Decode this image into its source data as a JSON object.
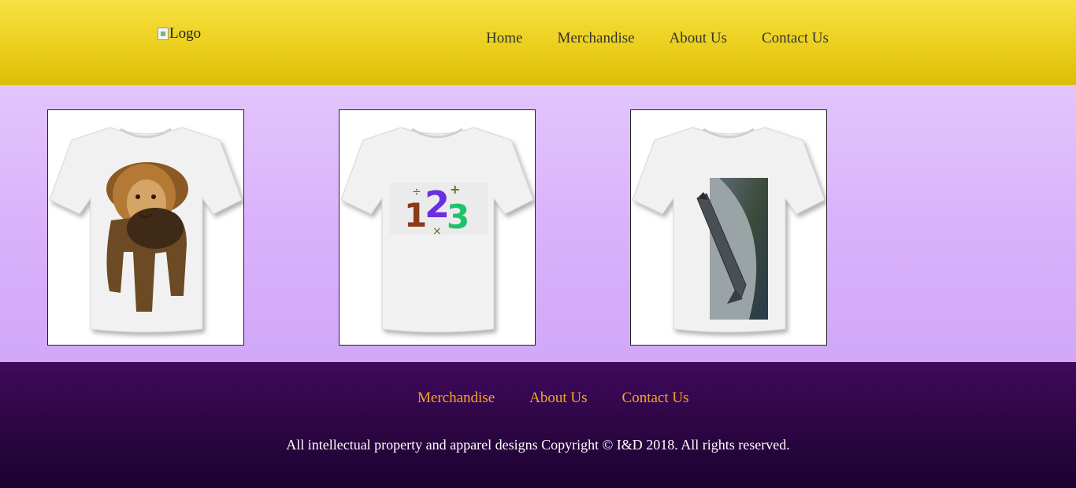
{
  "header": {
    "logo_alt": "Logo",
    "nav": [
      "Home",
      "Merchandise",
      "About Us",
      "Contact Us"
    ]
  },
  "products": [
    {
      "design": "lion"
    },
    {
      "design": "123",
      "glyphs": [
        "1",
        "2",
        "3",
        "÷",
        "+",
        "×"
      ]
    },
    {
      "design": "rocket"
    }
  ],
  "footer": {
    "nav": [
      "Merchandise",
      "About Us",
      "Contact Us"
    ],
    "copyright": "All intellectual property and apparel designs Copyright © I&D 2018. All rights reserved."
  },
  "colors": {
    "header_top": "#f8e143",
    "header_bottom": "#dcbd07",
    "main_bg": "#dab2fb",
    "footer_bg": "#2a0540",
    "footer_link": "#f5a623"
  }
}
